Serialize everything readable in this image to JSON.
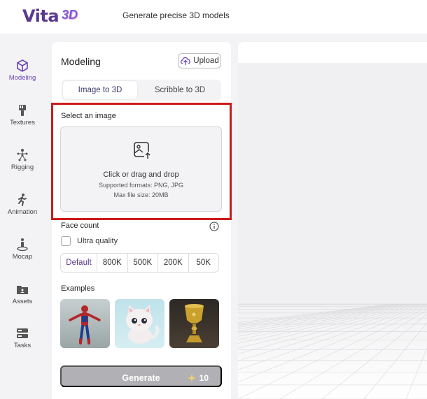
{
  "header": {
    "logo_text": "Vita",
    "logo_badge": "3D",
    "tagline": "Generate precise 3D models"
  },
  "nav": {
    "items": [
      {
        "label": "Modeling",
        "icon": "cube-icon",
        "active": true
      },
      {
        "label": "Textures",
        "icon": "brush-icon",
        "active": false
      },
      {
        "label": "Rigging",
        "icon": "skeleton-icon",
        "active": false
      },
      {
        "label": "Animation",
        "icon": "running-figure-icon",
        "active": false
      },
      {
        "label": "Mocap",
        "icon": "mocap-figure-icon",
        "active": false
      },
      {
        "label": "Assets",
        "icon": "folder-icon",
        "active": false
      },
      {
        "label": "Tasks",
        "icon": "tasks-icon",
        "active": false
      }
    ]
  },
  "panel": {
    "title": "Modeling",
    "upload_label": "Upload",
    "tabs": [
      {
        "label": "Image to 3D",
        "active": true
      },
      {
        "label": "Scribble to 3D",
        "active": false
      }
    ],
    "select_label": "Select an image",
    "dropzone": {
      "main": "Click or drag and drop",
      "formats": "Supported formats: PNG, JPG",
      "max_size": "Max file size: 20MB"
    },
    "face_count_label": "Face count",
    "ultra_quality_label": "Ultra quality",
    "face_options": [
      {
        "label": "Default",
        "active": true
      },
      {
        "label": "800K",
        "active": false
      },
      {
        "label": "500K",
        "active": false
      },
      {
        "label": "200K",
        "active": false
      },
      {
        "label": "50K",
        "active": false
      }
    ],
    "examples_label": "Examples",
    "generate_label": "Generate",
    "generate_cost": "10"
  },
  "colors": {
    "accent": "#6b45b5",
    "highlight_border": "#cc1a1a",
    "generate_disabled": "#b1b1b5"
  }
}
